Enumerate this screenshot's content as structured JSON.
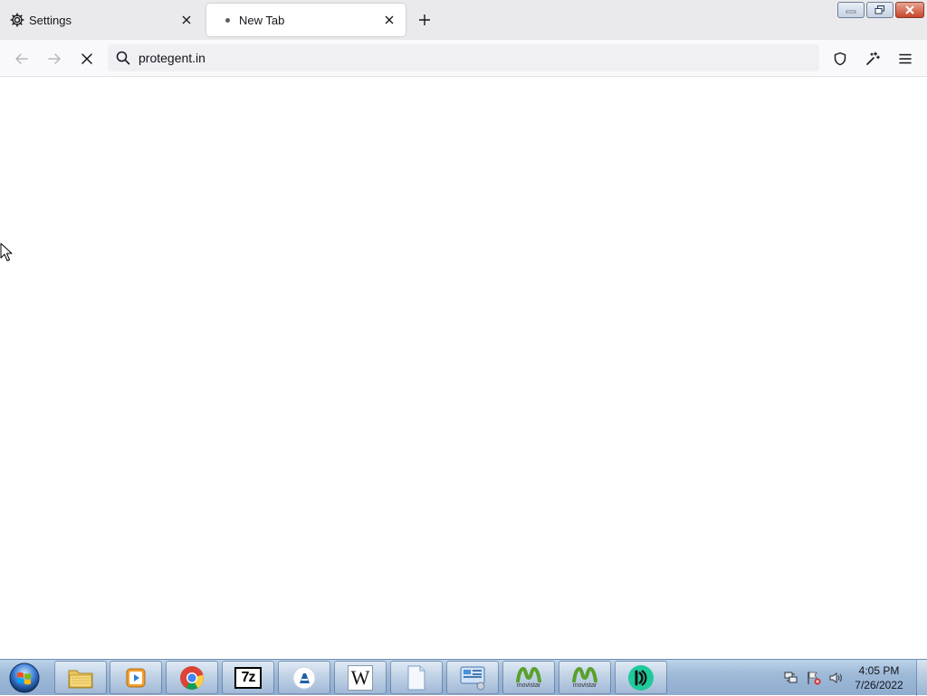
{
  "tabs": [
    {
      "title": "Settings",
      "icon": "gear-icon",
      "active": false
    },
    {
      "title": "New Tab",
      "icon": "loading-dot-icon",
      "active": true
    }
  ],
  "navbar": {
    "url": "protegent.in"
  },
  "taskbar": {
    "apps": [
      {
        "name": "windows-explorer",
        "icon": "folder-icon"
      },
      {
        "name": "media-player",
        "icon": "media-player-icon"
      },
      {
        "name": "chrome",
        "icon": "chrome-icon"
      },
      {
        "name": "7zip",
        "icon": "7zip-icon",
        "label": "7z"
      },
      {
        "name": "app-blue",
        "icon": "app-icon"
      },
      {
        "name": "wordpad",
        "icon": "wordpad-icon",
        "label": "W"
      },
      {
        "name": "blank-doc",
        "icon": "document-icon"
      },
      {
        "name": "control-panel",
        "icon": "control-panel-icon"
      },
      {
        "name": "movistar-1",
        "icon": "movistar-icon",
        "label": "movistar"
      },
      {
        "name": "movistar-2",
        "icon": "movistar-icon",
        "label": "movistar"
      },
      {
        "name": "green-app",
        "icon": "green-app-icon"
      }
    ],
    "clock": {
      "time": "4:05 PM",
      "date": "7/26/2022"
    }
  },
  "colors": {
    "tabstrip_bg": "#eaeaed",
    "navbar_bg": "#f9f9fb",
    "urlbar_bg": "#f0f0f4",
    "taskbar_bg": "#9fbad8"
  }
}
